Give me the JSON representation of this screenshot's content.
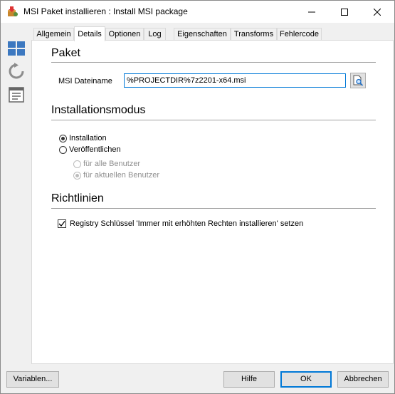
{
  "window": {
    "title": "MSI Paket installieren : Install MSI package"
  },
  "tabs": [
    "Allgemein",
    "Details",
    "Optionen",
    "Log",
    "Eigenschaften",
    "Transforms",
    "Fehlercode"
  ],
  "active_tab": "Details",
  "paket": {
    "heading": "Paket",
    "msi_label": "MSI Dateiname",
    "msi_value": "%PROJECTDIR%7z2201-x64.msi"
  },
  "installationsmodus": {
    "heading": "Installationsmodus",
    "options": [
      {
        "label": "Installation",
        "checked": true
      },
      {
        "label": "Veröffentlichen",
        "checked": false
      }
    ],
    "suboptions": [
      {
        "label": "für alle Benutzer",
        "checked": false,
        "disabled": true
      },
      {
        "label": "für aktuellen Benutzer",
        "checked": true,
        "disabled": true
      }
    ]
  },
  "richtlinien": {
    "heading": "Richtlinien",
    "checkbox_label": "Registry Schlüssel 'Immer mit erhöhten Rechten installieren' setzen",
    "checked": true
  },
  "footer": {
    "variables": "Variablen...",
    "help": "Hilfe",
    "ok": "OK",
    "cancel": "Abbrechen"
  },
  "icons": [
    "app-installer-icon",
    "grid-view-icon",
    "refresh-icon",
    "properties-icon",
    "browse-file-icon",
    "minimize-icon",
    "maximize-icon",
    "close-icon"
  ],
  "colors": {
    "accent": "#0078d7",
    "sidebar_blue": "#3c78c0"
  }
}
